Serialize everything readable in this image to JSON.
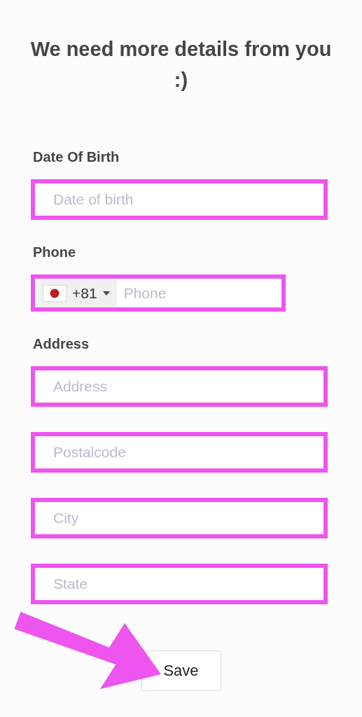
{
  "title": "We need more details from you :)",
  "sections": [
    {
      "label": "Date Of Birth",
      "fields": [
        {
          "kind": "text",
          "placeholder": "Date of birth",
          "highlighted": true
        }
      ]
    },
    {
      "label": "Phone",
      "fields": [
        {
          "kind": "phone",
          "country_code": "+81",
          "placeholder": "Phone",
          "highlighted": true
        }
      ]
    },
    {
      "label": "Address",
      "fields": [
        {
          "kind": "text",
          "placeholder": "Address",
          "highlighted": true
        },
        {
          "kind": "text",
          "placeholder": "Postalcode",
          "highlighted": true
        },
        {
          "kind": "text",
          "placeholder": "City",
          "highlighted": true
        },
        {
          "kind": "text",
          "placeholder": "State",
          "highlighted": true
        }
      ]
    }
  ],
  "save_button": {
    "label": "Save"
  }
}
